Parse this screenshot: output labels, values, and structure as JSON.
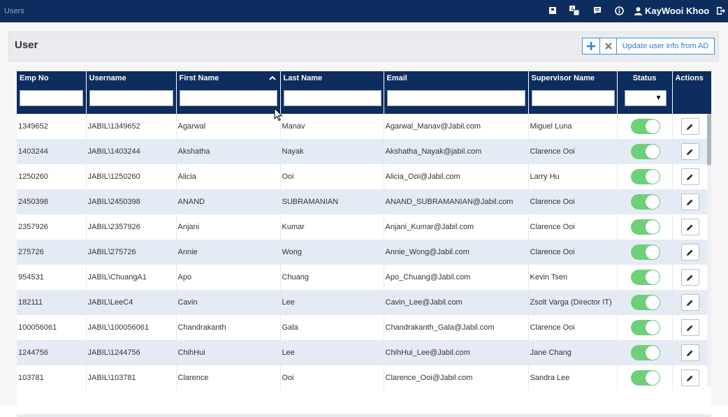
{
  "app": {
    "title": "Users"
  },
  "user": {
    "name": "KayWooi Khoo"
  },
  "header_icons": [
    "book-icon",
    "translate-icon",
    "message-icon",
    "info-icon",
    "user-icon",
    "logout-icon"
  ],
  "panel": {
    "title": "User",
    "update_label": "Update user info from AD"
  },
  "columns": {
    "emp_no": "Emp No",
    "username": "Username",
    "first_name": "First Name",
    "last_name": "Last Name",
    "email": "Email",
    "supervisor": "Supervisor Name",
    "status": "Status",
    "actions": "Actions"
  },
  "rows": [
    {
      "emp_no": "1349652",
      "username": "JABIL\\1349652",
      "first_name": "Agarwal",
      "last_name": "Manav",
      "email": "Agarwal_Manav@Jabil.com",
      "supervisor": "Miguel Luna",
      "status": true
    },
    {
      "emp_no": "1403244",
      "username": "JABIL\\1403244",
      "first_name": "Akshatha",
      "last_name": "Nayak",
      "email": "Akshatha_Nayak@jabil.com",
      "supervisor": "Clarence Ooi",
      "status": true
    },
    {
      "emp_no": "1250260",
      "username": "JABIL\\1250260",
      "first_name": "Alicia",
      "last_name": "Ooi",
      "email": "Alicia_Ooi@Jabil.com",
      "supervisor": "Larry Hu",
      "status": true
    },
    {
      "emp_no": "2450398",
      "username": "JABIL\\2450398",
      "first_name": "ANAND",
      "last_name": "SUBRAMANIAN",
      "email": "ANAND_SUBRAMANIAN@Jabil.com",
      "supervisor": "Clarence Ooi",
      "status": true
    },
    {
      "emp_no": "2357926",
      "username": "JABIL\\2357926",
      "first_name": "Anjani",
      "last_name": "Kumar",
      "email": "Anjani_Kumar@Jabil.com",
      "supervisor": "Clarence Ooi",
      "status": true
    },
    {
      "emp_no": "275726",
      "username": "JABIL\\275726",
      "first_name": "Annie",
      "last_name": "Wong",
      "email": "Annie_Wong@Jabil.com",
      "supervisor": "Clarence Ooi",
      "status": true
    },
    {
      "emp_no": "954531",
      "username": "JABIL\\ChuangA1",
      "first_name": "Apo",
      "last_name": "Chuang",
      "email": "Apo_Chuang@Jabil.com",
      "supervisor": "Kevin Tsen",
      "status": true
    },
    {
      "emp_no": "182111",
      "username": "JABIL\\LeeC4",
      "first_name": "Cavin",
      "last_name": "Lee",
      "email": "Cavin_Lee@Jabil.com",
      "supervisor": "Zsolt Varga (Director IT)",
      "status": true
    },
    {
      "emp_no": "100056061",
      "username": "JABIL\\100056061",
      "first_name": "Chandrakanth",
      "last_name": "Gala",
      "email": "Chandrakanth_Gala@Jabil.com",
      "supervisor": "Clarence Ooi",
      "status": true
    },
    {
      "emp_no": "1244756",
      "username": "JABIL\\1244756",
      "first_name": "ChihHui",
      "last_name": "Lee",
      "email": "ChihHui_Lee@Jabil.com",
      "supervisor": "Jane Chang",
      "status": true
    },
    {
      "emp_no": "103781",
      "username": "JABIL\\103781",
      "first_name": "Clarence",
      "last_name": "Ooi",
      "email": "Clarence_Ooi@Jabil.com",
      "supervisor": "Sandra Lee",
      "status": true
    }
  ],
  "colors": {
    "nav": "#0d2d5e",
    "accent": "#3a8fd8",
    "toggle_on": "#6fd07a",
    "row_alt": "#e4ebf5"
  }
}
